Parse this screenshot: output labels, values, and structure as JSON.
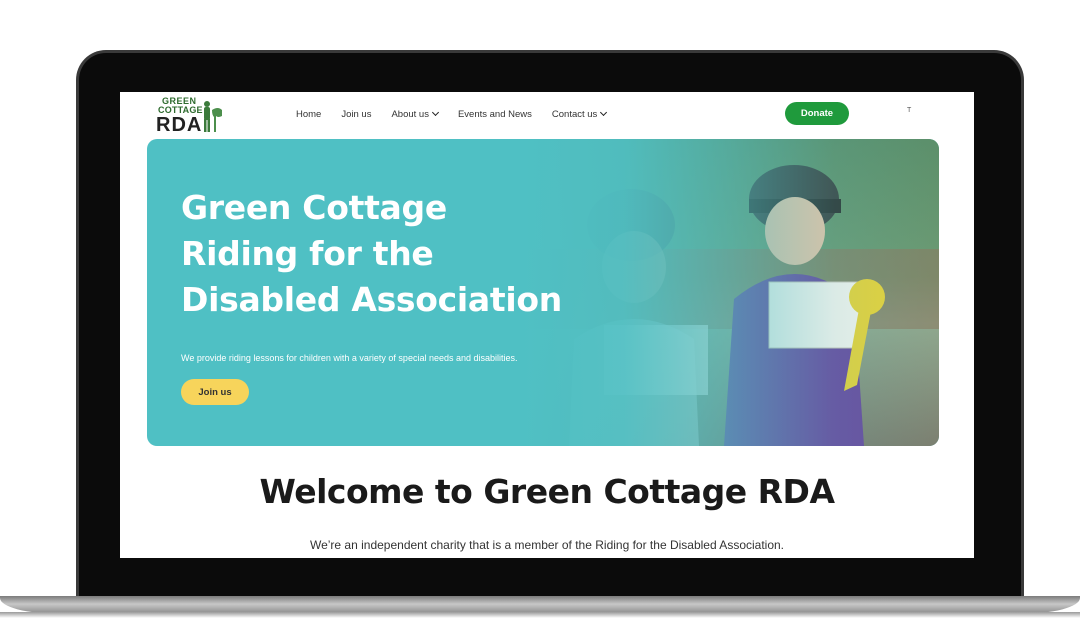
{
  "header": {
    "logo": {
      "line1": "GREEN",
      "line2": "COTTAGE",
      "line3": "RDA"
    },
    "nav": [
      {
        "label": "Home"
      },
      {
        "label": "Join us"
      },
      {
        "label": "About us",
        "dropdown": true
      },
      {
        "label": "Events and News"
      },
      {
        "label": "Contact us",
        "dropdown": true
      }
    ],
    "donate_label": "Donate",
    "small_text": "T"
  },
  "hero": {
    "title_line1": "Green Cottage",
    "title_line2": "Riding for the",
    "title_line3": "Disabled Association",
    "subtitle": "We provide riding lessons for children with a variety of special needs and disabilities.",
    "cta_label": "Join us"
  },
  "welcome": {
    "heading": "Welcome to Green Cottage RDA",
    "intro": "We’re an independent charity that is a member of the Riding for the Disabled Association."
  },
  "colors": {
    "hero_bg": "#4fc0c4",
    "donate": "#1f9a3c",
    "join": "#f7d45b",
    "logo_green": "#2e6b2e"
  }
}
